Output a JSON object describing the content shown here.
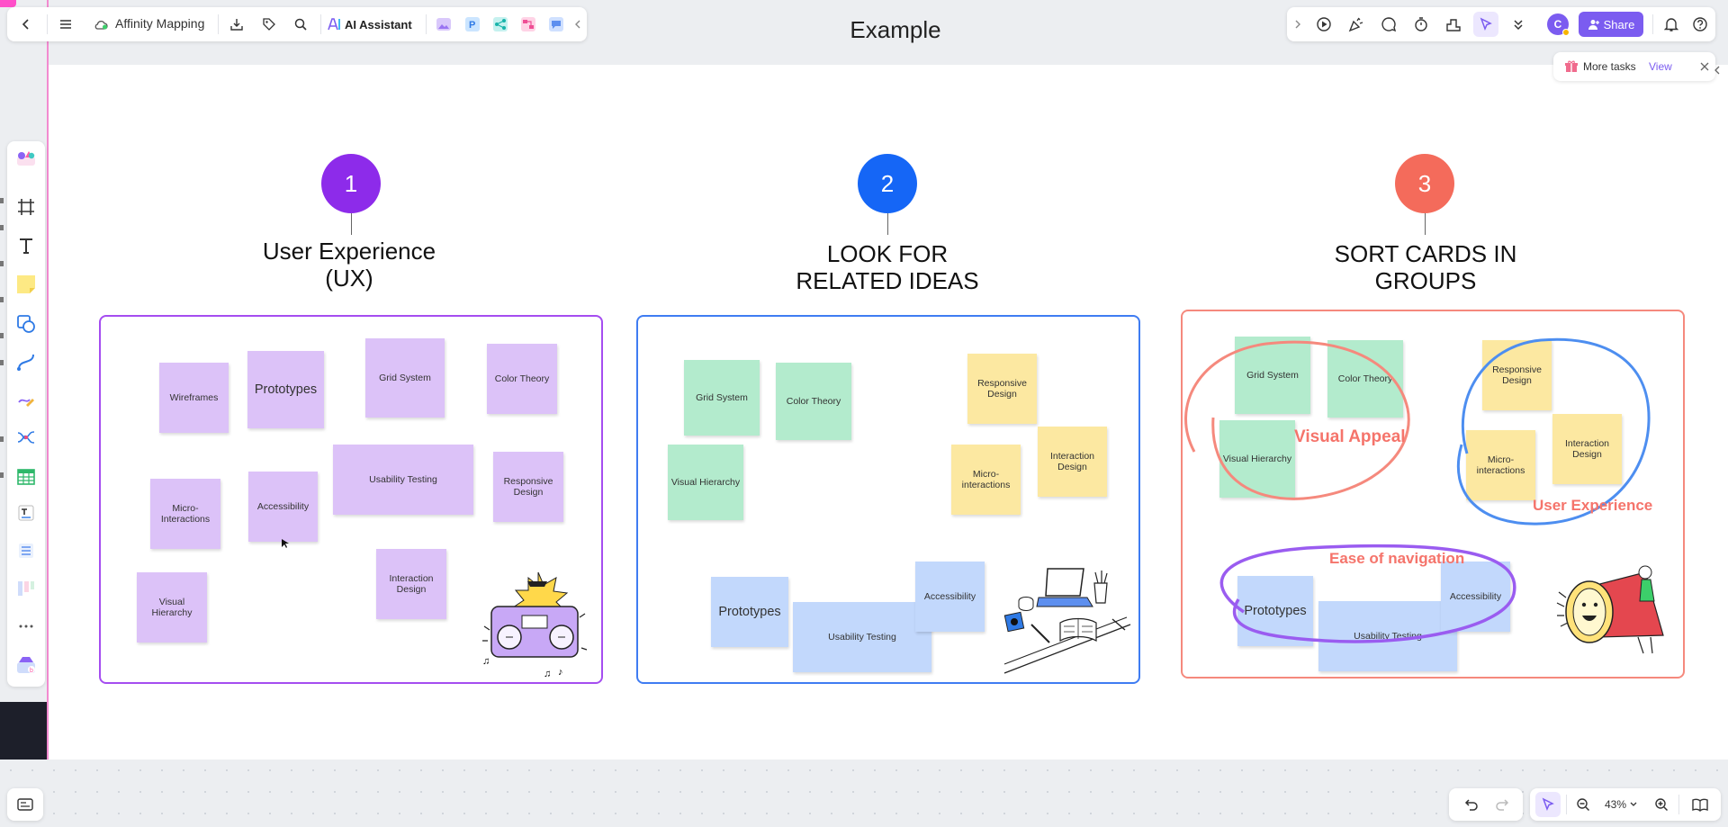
{
  "app": {
    "file_name": "Affinity Mapping",
    "ai_assistant_label": "AI Assistant",
    "board_title": "Example",
    "share_label": "Share",
    "avatar_initial": "C"
  },
  "tasks_card": {
    "label": "More tasks",
    "view_label": "View"
  },
  "zoom": {
    "value": "43%"
  },
  "steps": [
    {
      "number": "1",
      "title_line1": "User Experience",
      "title_line2": "(UX)",
      "color": "#8d2bea"
    },
    {
      "number": "2",
      "title_line1": "LOOK FOR",
      "title_line2": "RELATED IDEAS",
      "color": "#1566f6"
    },
    {
      "number": "3",
      "title_line1": "SORT CARDS IN",
      "title_line2": "GROUPS",
      "color": "#f46b5b"
    }
  ],
  "group1": {
    "border_color": "#a54df0",
    "notes": [
      "Wireframes",
      "Prototypes",
      "Grid System",
      "Color Theory",
      "Micro-\nInteractions",
      "Accessibility",
      "Usability Testing",
      "Responsive\nDesign",
      "Visual\nHierarchy",
      "Interaction\nDesign"
    ]
  },
  "group2": {
    "border_color": "#3f7cf2",
    "notes": [
      "Grid System",
      "Color Theory",
      "Visual Hierarchy",
      "Responsive\nDesign",
      "Micro-\ninteractions",
      "Interaction\nDesign",
      "Prototypes",
      "Usability Testing",
      "Accessibility"
    ]
  },
  "group3": {
    "border_color": "#f5897d",
    "notes": [
      "Grid System",
      "Color Theory",
      "Visual Hierarchy",
      "Responsive\nDesign",
      "Micro-\ninteractions",
      "Interaction\nDesign",
      "Prototypes",
      "Usability Testing",
      "Accessibility"
    ],
    "labels": [
      "Visual Appeal",
      "User Experience",
      "Ease of navigation"
    ],
    "label_color": "#f5746b"
  },
  "colors": {
    "accent": "#7b5cf0",
    "sticky_purple": "#dcc2f8",
    "sticky_green": "#b3ebcd",
    "sticky_yellow": "#fce8a1",
    "sticky_blue": "#c2d8fc"
  }
}
